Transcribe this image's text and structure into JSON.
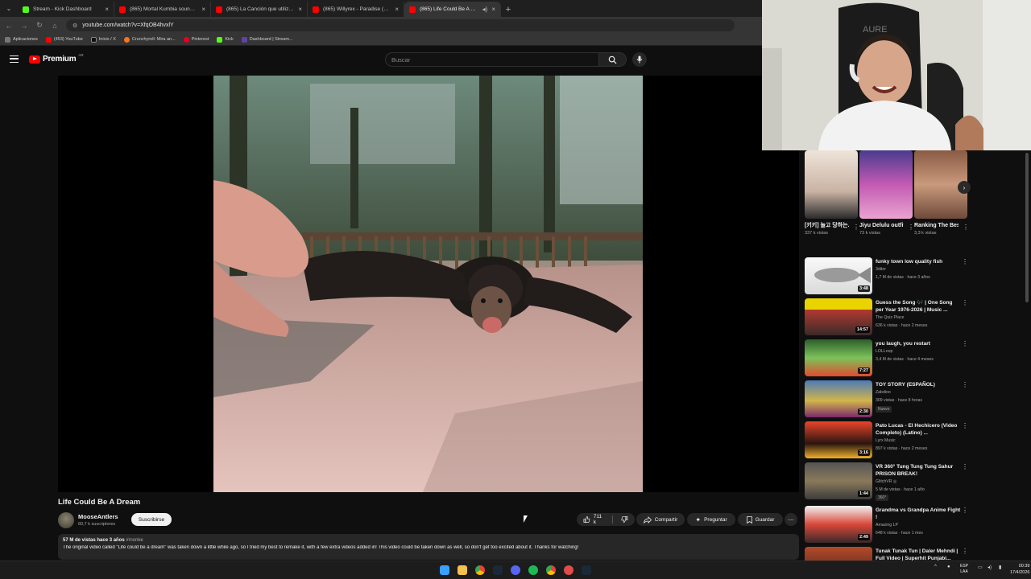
{
  "browser": {
    "tabs": [
      {
        "label": "Stream - Kick Dashboard",
        "color": "#53fc18"
      },
      {
        "label": "(865) Mortal Kumbia soundtra...",
        "color": "#ff0000"
      },
      {
        "label": "(865) La Canción que utiliza W...",
        "color": "#ff0000"
      },
      {
        "label": "(865) Willyrex - Paradise (Letra...",
        "color": "#ff0000"
      },
      {
        "label": "(865) Life Could Be A Dream",
        "color": "#ff0000"
      }
    ],
    "active_tab": 4,
    "url": "youtube.com/watch?v=XfqOB4hvxlY",
    "bookmarks": [
      {
        "label": "Aplicaciones",
        "color": "#777777"
      },
      {
        "label": "(453) YouTube",
        "color": "#ff0000"
      },
      {
        "label": "Inicio / X",
        "color": "#111111"
      },
      {
        "label": "Crunchyroll: Mira an...",
        "color": "#f47521"
      },
      {
        "label": "Pinterest",
        "color": "#e60023"
      },
      {
        "label": "Kick",
        "color": "#53fc18"
      },
      {
        "label": "Dashboard | Stream...",
        "color": "#6441a5"
      }
    ]
  },
  "youtube": {
    "logo_text": "Premium",
    "logo_region": "AR",
    "search_placeholder": "Buscar"
  },
  "video": {
    "title": "Life Could Be A Dream",
    "channel": "MooseAntlers",
    "subscribers": "60,7 k suscriptores",
    "subscribe_label": "Suscribirse",
    "likes": "711 k",
    "share_label": "Compartir",
    "ask_label": "Preguntar",
    "save_label": "Guardar",
    "views_date": "57 M de vistas  hace 3 años",
    "hashtag": "#monke",
    "description": "The original video called \"Life could be a dream\" was taken down a little while ago, so I tried my best to remake it, with a few extra videos added in! This video could be taken down as well, so don't get too excited about it. Thanks for watching!"
  },
  "shorts": [
    {
      "title": "[키키] 놀고 당하는...",
      "views": "337 k vistas"
    },
    {
      "title": "Jiyu Delulu outfit ...",
      "views": "73 k vistas"
    },
    {
      "title": "Ranking The Best Funny ...",
      "views": "3,3 k vistas"
    }
  ],
  "recommendations": [
    {
      "title": "funky town low quality fish",
      "channel": "3ditor",
      "meta": "1,7 M de vistas · hace 3 años",
      "duration": "3:48",
      "badge": ""
    },
    {
      "title": "Guess the Song 🎶 | One Song per Year 1976-2026 | Music ...",
      "channel": "The Quiz Place",
      "meta": "636 k vistas · hace 2 meses",
      "duration": "14:57",
      "badge": ""
    },
    {
      "title": "you laugh, you restart",
      "channel": "LOLLoop",
      "meta": "3,4 M de vistas · hace 4 meses",
      "duration": "7:27",
      "badge": ""
    },
    {
      "title": "TOY STORY (ESPAÑOL)",
      "channel": "Zabdioo",
      "meta": "309 vistas · hace 8 horas",
      "duration": "2:30",
      "badge": "Nuevo"
    },
    {
      "title": "Pato Lucas -  El Hechicero (Video Completo) (Latino) ...",
      "channel": "Lyrx Music",
      "meta": "897 k vistas · hace 2 meses",
      "duration": "3:16",
      "badge": ""
    },
    {
      "title": "VR 360° Tung Tung Tung Sahur PRISON BREAK!",
      "channel": "GlitchVR ◎",
      "meta": "5 M de vistas · hace 1 año",
      "duration": "1:44",
      "badge": "360°"
    },
    {
      "title": "Grandma vs Grandpa Anime Fight !",
      "channel": "Amazing LP",
      "meta": "648 k vistas · hace 1 mes",
      "duration": "2:49",
      "badge": ""
    },
    {
      "title": "Tunak Tunak Tun | Daler Mehndi | Full Video | Superhit Punjabi...",
      "channel": "",
      "meta": "",
      "duration": "",
      "badge": ""
    }
  ],
  "taskbar": {
    "lang_top": "ESP",
    "lang_bottom": "LAA",
    "time": "00:39",
    "date": "17/4/2026"
  }
}
